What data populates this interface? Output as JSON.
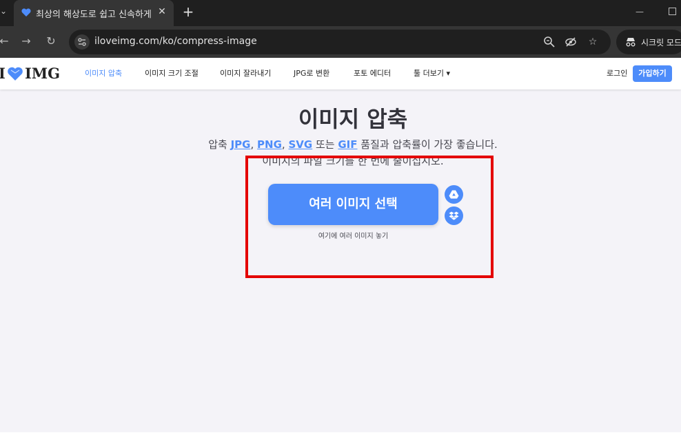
{
  "browser": {
    "tab_title": "최상의 해상도로 쉽고 신속하게",
    "tab_close": "✕",
    "new_tab": "+",
    "url": "iloveimg.com/ko/compress-image",
    "incognito_label": "시크릿 모드"
  },
  "site": {
    "logo_left": "I",
    "logo_right": "IMG",
    "nav": [
      {
        "label": "이미지 압축"
      },
      {
        "label": "이미지 크기 조절"
      },
      {
        "label": "이미지 잘라내기"
      },
      {
        "label": "JPG로 변환"
      },
      {
        "label": "포토 에디터"
      },
      {
        "label": "툴 더보기 ▾"
      }
    ],
    "login": "로그인",
    "signup": "가입하기"
  },
  "main": {
    "title": "이미지 압축",
    "subtitle_prefix": "압축",
    "formats": [
      "JPG",
      "PNG",
      "SVG",
      "GIF"
    ],
    "sep1": ",",
    "sep2": ",",
    "sep3": "또는",
    "subtitle_suffix": "품질과 압축률이 가장 좋습니다.",
    "subtitle_line2": "이미지의 파일 크기를 한 번에 줄이십시오.",
    "select_button": "여러 이미지 선택",
    "drop_hint": "여기에 여러 이미지 놓기"
  },
  "colors": {
    "accent": "#4d8cfa",
    "highlight": "#e40000"
  },
  "icons": {
    "drive": "google-drive-icon",
    "dropbox": "dropbox-icon"
  }
}
